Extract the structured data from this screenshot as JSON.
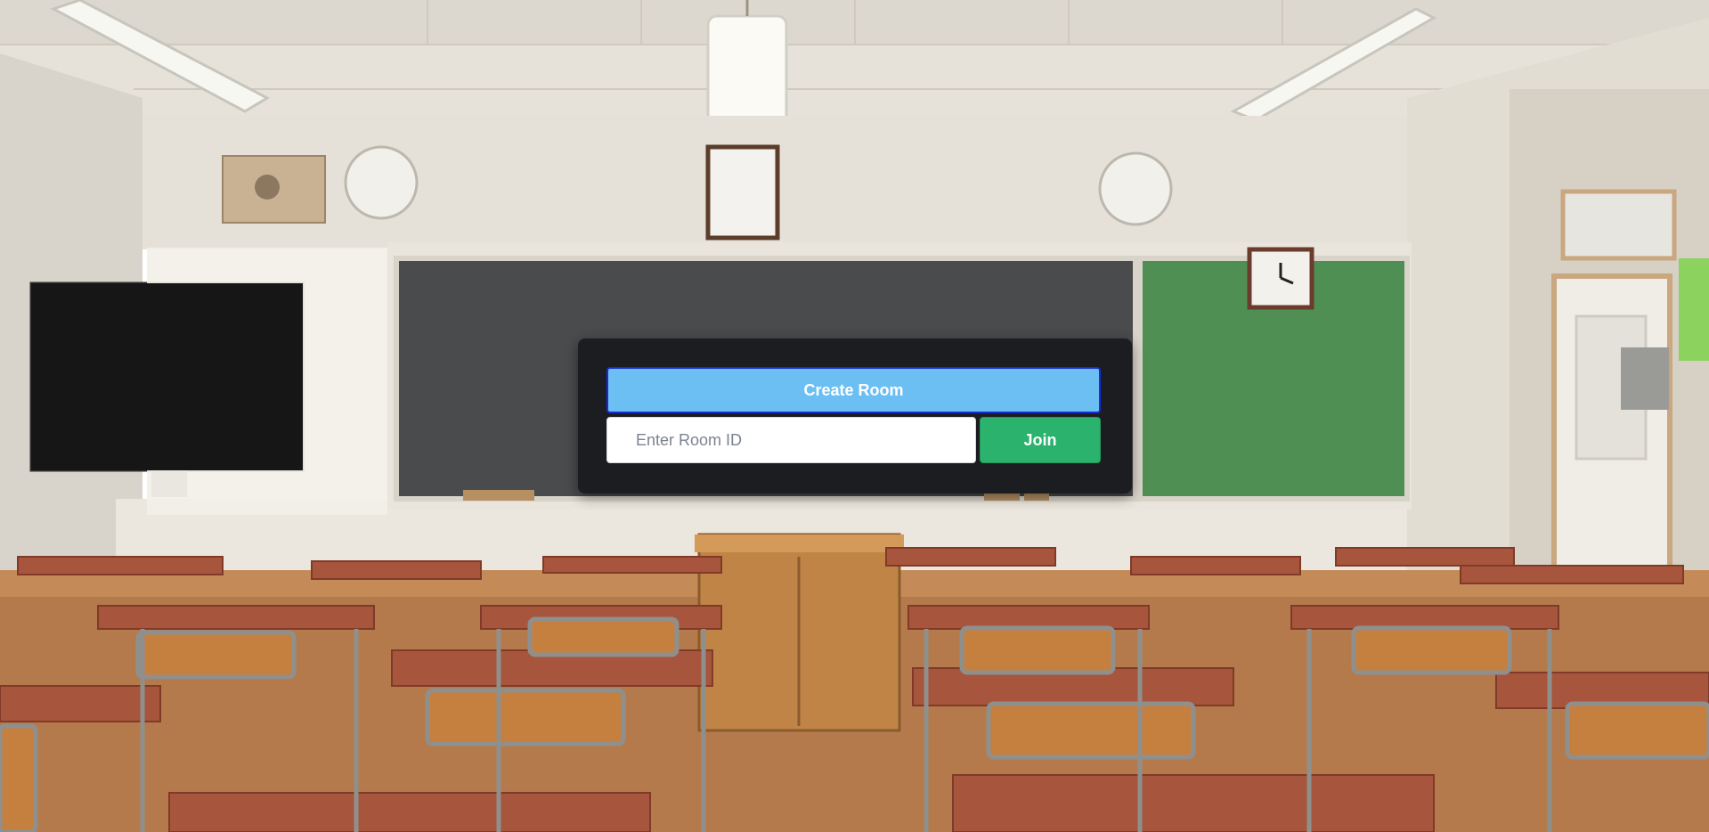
{
  "room": {
    "create_label": "Create Room",
    "input_placeholder": "Enter Room ID",
    "input_value": "",
    "join_label": "Join"
  },
  "colors": {
    "create_bg": "#6cbff3",
    "create_border": "#1a2bd6",
    "join_bg": "#2bb26c",
    "panel_bg": "#1c1d20"
  },
  "background": {
    "scene": "classroom-photo"
  }
}
